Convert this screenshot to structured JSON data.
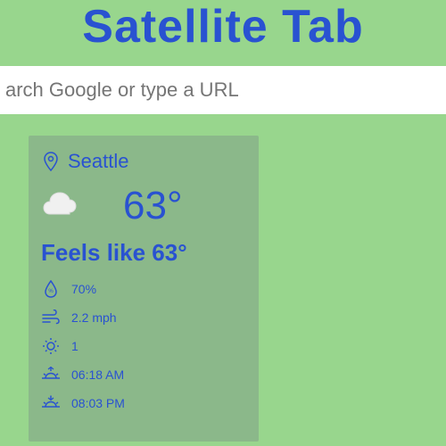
{
  "header": {
    "title": "Satellite Tab"
  },
  "search": {
    "placeholder": "arch Google or type a URL"
  },
  "weather": {
    "location": "Seattle",
    "temperature": "63°",
    "feels_like": "Feels like 63°",
    "humidity": "70%",
    "wind": "2.2 mph",
    "uv": "1",
    "sunrise": "06:18 AM",
    "sunset": "08:03 PM"
  }
}
